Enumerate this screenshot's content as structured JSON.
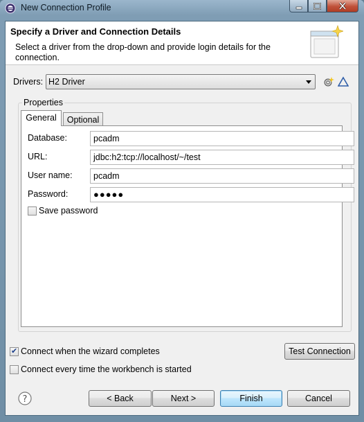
{
  "window": {
    "title": "New Connection Profile"
  },
  "header": {
    "title": "Specify a Driver and Connection Details",
    "description": "Select a driver from the drop-down and provide login details for the connection."
  },
  "drivers": {
    "label": "Drivers:",
    "selected": "H2 Driver"
  },
  "properties": {
    "group_label": "Properties",
    "tabs": [
      {
        "label": "General",
        "active": true
      },
      {
        "label": "Optional",
        "active": false
      }
    ],
    "fields": {
      "database": {
        "label": "Database:",
        "value": "pcadm"
      },
      "url": {
        "label": "URL:",
        "value": "jdbc:h2:tcp://localhost/~/test"
      },
      "username": {
        "label": "User name:",
        "value": "pcadm"
      },
      "password": {
        "label": "Password:",
        "value": "●●●●●"
      }
    },
    "save_password": {
      "label": "Save password",
      "checked": false
    }
  },
  "options": {
    "connect_on_complete": {
      "label": "Connect when the wizard completes",
      "checked": true
    },
    "connect_on_startup": {
      "label": "Connect every time the workbench is started",
      "checked": false
    }
  },
  "buttons": {
    "test_connection": "Test Connection",
    "back": "< Back",
    "next": "Next >",
    "finish": "Finish",
    "cancel": "Cancel"
  },
  "colors": {
    "title_gradient_top": "#9bb6cc",
    "default_button_border": "#3c7fb1",
    "close_button": "#c0513a"
  },
  "icons": {
    "app": "eclipse-icon",
    "new_driver": "new-driver-icon",
    "edit_driver": "edit-driver-icon",
    "help": "help-icon",
    "wizard_banner": "connection-wizard-icon"
  }
}
